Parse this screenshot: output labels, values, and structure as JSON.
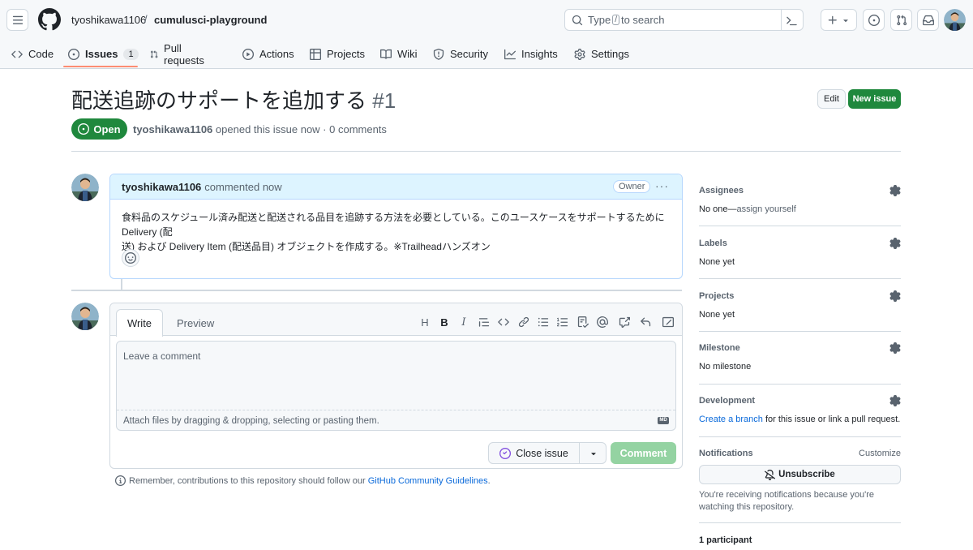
{
  "header": {
    "owner": "tyoshikawa1106",
    "separator": "/",
    "repo": "cumulusci-playground",
    "search_prefix": "Type",
    "search_key": "/",
    "search_suffix": "to search"
  },
  "tabs": [
    {
      "label": "Code",
      "icon": "code-icon"
    },
    {
      "label": "Issues",
      "icon": "issue-opened-icon",
      "count": "1",
      "active": true
    },
    {
      "label": "Pull requests",
      "icon": "git-pull-request-icon"
    },
    {
      "label": "Actions",
      "icon": "play-icon"
    },
    {
      "label": "Projects",
      "icon": "table-icon"
    },
    {
      "label": "Wiki",
      "icon": "book-icon"
    },
    {
      "label": "Security",
      "icon": "shield-icon"
    },
    {
      "label": "Insights",
      "icon": "graph-icon"
    },
    {
      "label": "Settings",
      "icon": "gear-icon"
    }
  ],
  "issue": {
    "title": "配送追跡のサポートを追加する",
    "number": "#1",
    "state": "Open",
    "author": "tyoshikawa1106",
    "meta_text": "opened this issue now · 0 comments",
    "edit_label": "Edit",
    "new_issue_label": "New issue"
  },
  "comment": {
    "author": "tyoshikawa1106",
    "time": "commented now",
    "role": "Owner",
    "body_line1": "食料品のスケジュール済み配送と配送される品目を追跡する方法を必要としている。このユースケースをサポートするために Delivery (配",
    "body_line2": "送) および Delivery Item (配送品目) オブジェクトを作成する。※Trailheadハンズオン"
  },
  "composer": {
    "tab_write": "Write",
    "tab_preview": "Preview",
    "placeholder": "Leave a comment",
    "attach_text": "Attach files by dragging & dropping, selecting or pasting them.",
    "close_label": "Close issue",
    "comment_label": "Comment",
    "md_badge": "MD"
  },
  "guidelines": {
    "prefix": "Remember, contributions to this repository should follow our",
    "link": "GitHub Community Guidelines",
    "suffix": "."
  },
  "sidebar": {
    "assignees": {
      "title": "Assignees",
      "value_prefix": "No one—",
      "value_link": "assign yourself"
    },
    "labels": {
      "title": "Labels",
      "value": "None yet"
    },
    "projects": {
      "title": "Projects",
      "value": "None yet"
    },
    "milestone": {
      "title": "Milestone",
      "value": "No milestone"
    },
    "development": {
      "title": "Development",
      "link": "Create a branch",
      "suffix": " for this issue or link a pull request."
    },
    "notifications": {
      "title": "Notifications",
      "customize": "Customize",
      "button": "Unsubscribe",
      "note": "You're receiving notifications because you're watching this repository."
    },
    "participants": {
      "title": "1 participant"
    }
  },
  "colors": {
    "primary_green": "#1f883d",
    "tab_underline": "#fd8c73",
    "link_blue": "#0969da",
    "comment_header": "#ddf4ff"
  }
}
